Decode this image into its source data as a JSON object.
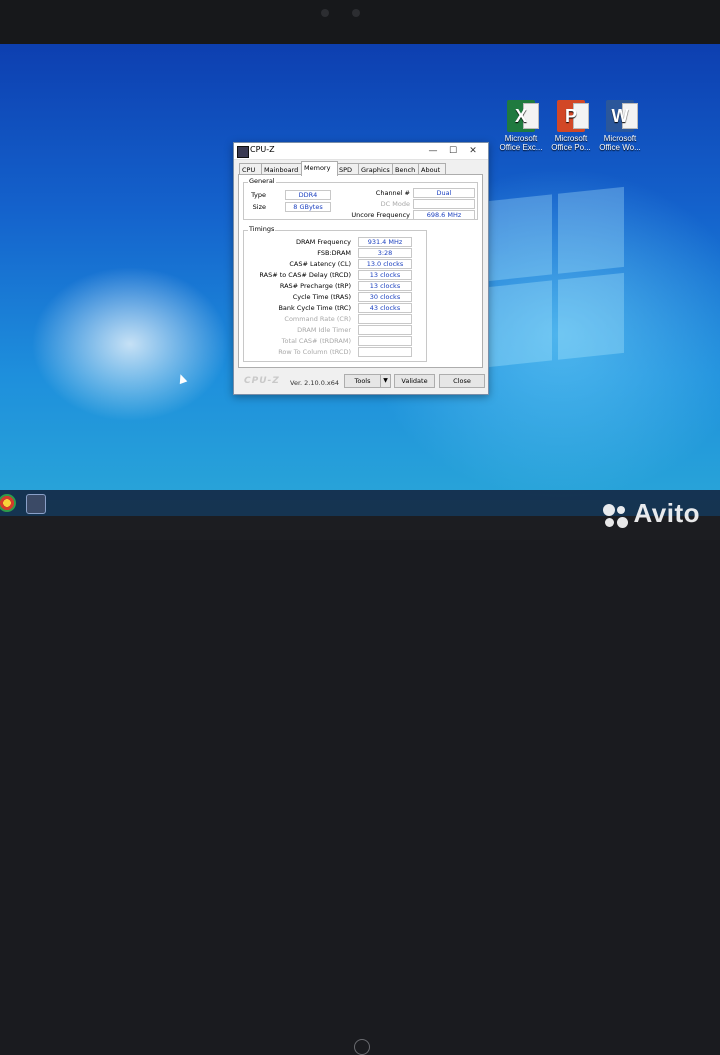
{
  "desktop": {
    "icons": [
      {
        "glyph": "X",
        "line1": "Microsoft",
        "line2": "Office Exc..."
      },
      {
        "glyph": "P",
        "line1": "Microsoft",
        "line2": "Office Po..."
      },
      {
        "glyph": "W",
        "line1": "Microsoft",
        "line2": "Office Wo..."
      }
    ]
  },
  "cpuz": {
    "title": "CPU-Z",
    "controls": {
      "minimize": "—",
      "maximize": "☐",
      "close": "✕"
    },
    "tabs": [
      "CPU",
      "Mainboard",
      "Memory",
      "SPD",
      "Graphics",
      "Bench",
      "About"
    ],
    "active_tab": "Memory",
    "general": {
      "title": "General",
      "type_label": "Type",
      "type_value": "DDR4",
      "size_label": "Size",
      "size_value": "8 GBytes",
      "channel_label": "Channel #",
      "channel_value": "Dual",
      "dc_mode_label": "DC Mode",
      "dc_mode_value": "",
      "uncore_label": "Uncore Frequency",
      "uncore_value": "698.6 MHz"
    },
    "timings": {
      "title": "Timings",
      "rows": [
        {
          "label": "DRAM Frequency",
          "value": "931.4 MHz",
          "dim": false
        },
        {
          "label": "FSB:DRAM",
          "value": "3:28",
          "dim": false
        },
        {
          "label": "CAS# Latency (CL)",
          "value": "13.0 clocks",
          "dim": false
        },
        {
          "label": "RAS# to CAS# Delay (tRCD)",
          "value": "13 clocks",
          "dim": false
        },
        {
          "label": "RAS# Precharge (tRP)",
          "value": "13 clocks",
          "dim": false
        },
        {
          "label": "Cycle Time (tRAS)",
          "value": "30 clocks",
          "dim": false
        },
        {
          "label": "Bank Cycle Time (tRC)",
          "value": "43 clocks",
          "dim": false
        },
        {
          "label": "Command Rate (CR)",
          "value": "",
          "dim": true
        },
        {
          "label": "DRAM Idle Timer",
          "value": "",
          "dim": true
        },
        {
          "label": "Total CAS# (tRDRAM)",
          "value": "",
          "dim": true
        },
        {
          "label": "Row To Column (tRCD)",
          "value": "",
          "dim": true
        }
      ]
    },
    "footer": {
      "logo": "CPU-Z",
      "version": "Ver. 2.10.0.x64",
      "tools_label": "Tools",
      "dropdown_arrow": "▼",
      "validate_label": "Validate",
      "close_label": "Close"
    }
  },
  "watermark": "Avito"
}
